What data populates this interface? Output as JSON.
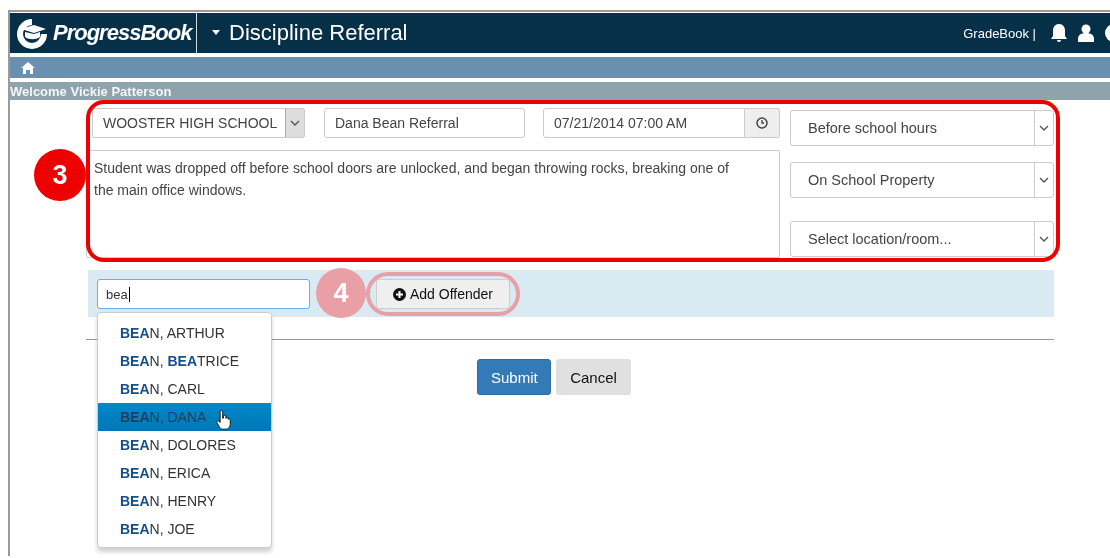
{
  "header": {
    "logo": "ProgressBook",
    "title": "Discipline Referral",
    "link": "GradeBook |"
  },
  "welcome": "Welcome Vickie Patterson",
  "form": {
    "school": "WOOSTER HIGH SCHOOL",
    "referral_name": "Dana Bean Referral",
    "date_time": "07/21/2014 07:00 AM",
    "description": "Student was dropped off before school doors are unlocked, and began throwing rocks, breaking one of the main office windows.",
    "selects": [
      "Before school hours",
      "On School Property",
      "Select location/room..."
    ]
  },
  "offender": {
    "search": "bea",
    "button": "Add Offender"
  },
  "suggestions": [
    {
      "label": "**BEA**N, ARTHUR",
      "selected": false
    },
    {
      "label": "**BEA**N, **BEA**TRICE",
      "selected": false
    },
    {
      "label": "**BEA**N, CARL",
      "selected": false
    },
    {
      "label": "**BEA**N, DANA",
      "selected": true
    },
    {
      "label": "**BEA**N, DOLORES",
      "selected": false
    },
    {
      "label": "**BEA**N, ERICA",
      "selected": false
    },
    {
      "label": "**BEA**N, HENRY",
      "selected": false
    },
    {
      "label": "**BEA**N, JOE",
      "selected": false
    }
  ],
  "actions": [
    {
      "label": "Submit",
      "kind": "primary"
    },
    {
      "label": "Cancel",
      "kind": "default"
    }
  ],
  "callouts": [
    {
      "number": "3",
      "color": "#ee0000"
    },
    {
      "number": "4",
      "color": "#e8a0a6"
    }
  ]
}
